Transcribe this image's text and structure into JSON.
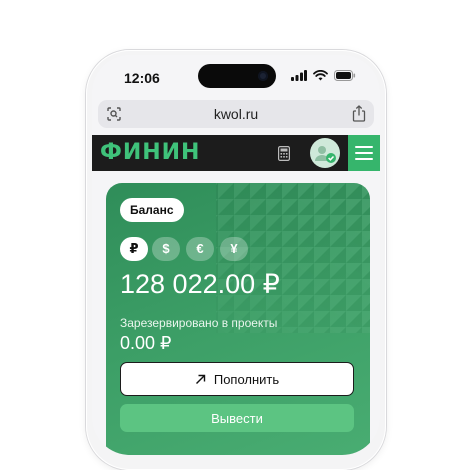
{
  "status_bar": {
    "time": "12:06"
  },
  "browser": {
    "url": "kwol.ru"
  },
  "header": {
    "logo": "ФИНИН"
  },
  "balance": {
    "badge": "Баланс",
    "currencies": [
      "₽",
      "$",
      "€",
      "¥"
    ],
    "selected_currency": "₽",
    "amount": "128 022.00 ₽",
    "reserved_label": "Зарезервировано в проекты",
    "reserved_value": "0.00 ₽",
    "topup_label": "Пополнить",
    "withdraw_label": "Вывести"
  },
  "colors": {
    "brand_green": "#36b56c",
    "card_green": "#3c9e66",
    "header_dark": "#1c1c1c"
  }
}
